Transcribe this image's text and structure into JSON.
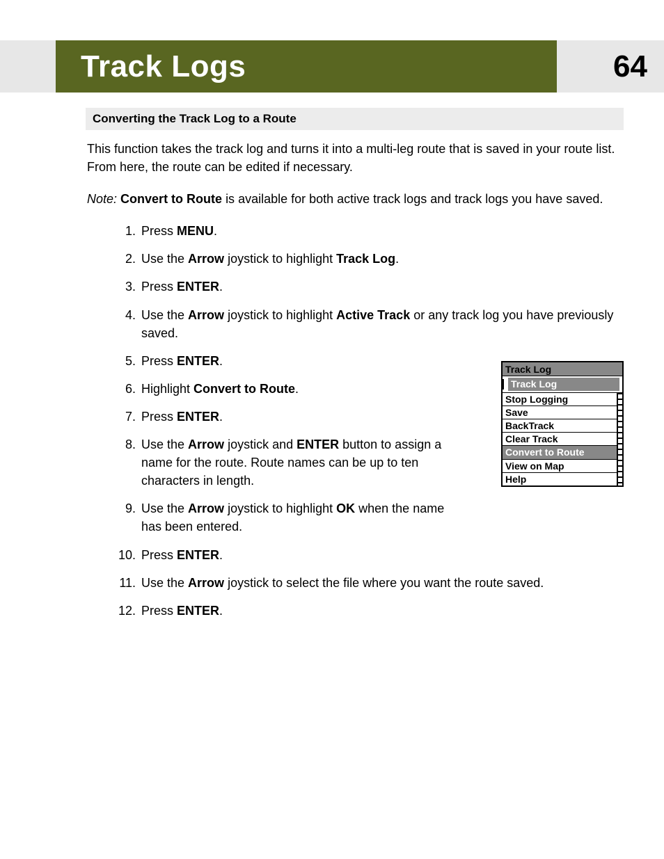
{
  "header": {
    "title": "Track Logs",
    "page_number": "64"
  },
  "section_heading": "Converting the Track Log to a Route",
  "intro": "This function takes the track log and turns it into a multi-leg route that is saved in your route list.  From here, the route can be edited if necessary.",
  "note": {
    "label": "Note:",
    "feature": "Convert to Route",
    "rest": " is available for both active track logs and track logs you have saved."
  },
  "terms": {
    "menu": "MENU",
    "enter": "ENTER",
    "arrow": "Arrow",
    "track_log": "Track Log",
    "active_track": "Active Track",
    "convert_to_route": "Convert to Route",
    "ok": "OK"
  },
  "steps": {
    "s1": {
      "num": "1.",
      "a": "Press ",
      "c": "."
    },
    "s2": {
      "num": "2.",
      "a": "Use the ",
      "b": " joystick to highlight ",
      "c": "."
    },
    "s3": {
      "num": "3.",
      "a": "Press ",
      "c": "."
    },
    "s4": {
      "num": "4.",
      "a": "Use the ",
      "b": " joystick to highlight ",
      "c": " or any track log you have previously saved."
    },
    "s5": {
      "num": "5.",
      "a": "Press ",
      "c": "."
    },
    "s6": {
      "num": "6.",
      "a": "Highlight ",
      "c": "."
    },
    "s7": {
      "num": "7.",
      "a": "Press ",
      "c": "."
    },
    "s8": {
      "num": "8.",
      "a": "Use the ",
      "b": " joystick and ",
      "c": " button to assign a name for the route.  Route names can be up to ten characters in length."
    },
    "s9": {
      "num": "9.",
      "a": "Use the ",
      "b": " joystick to highlight ",
      "c": " when the name has been entered."
    },
    "s10": {
      "num": "10.",
      "a": "Press ",
      "c": "."
    },
    "s11": {
      "num": "11.",
      "a": "Use the ",
      "b": " joystick to select the file where you want the route saved."
    },
    "s12": {
      "num": "12.",
      "a": "Press ",
      "c": "."
    }
  },
  "device_menu": {
    "title": "Track Log",
    "subtitle": "Track Log",
    "items": [
      "Stop Logging",
      "Save",
      "BackTrack",
      "Clear Track",
      "Convert to Route",
      "View on Map",
      "Help"
    ],
    "highlight_index": 4
  }
}
